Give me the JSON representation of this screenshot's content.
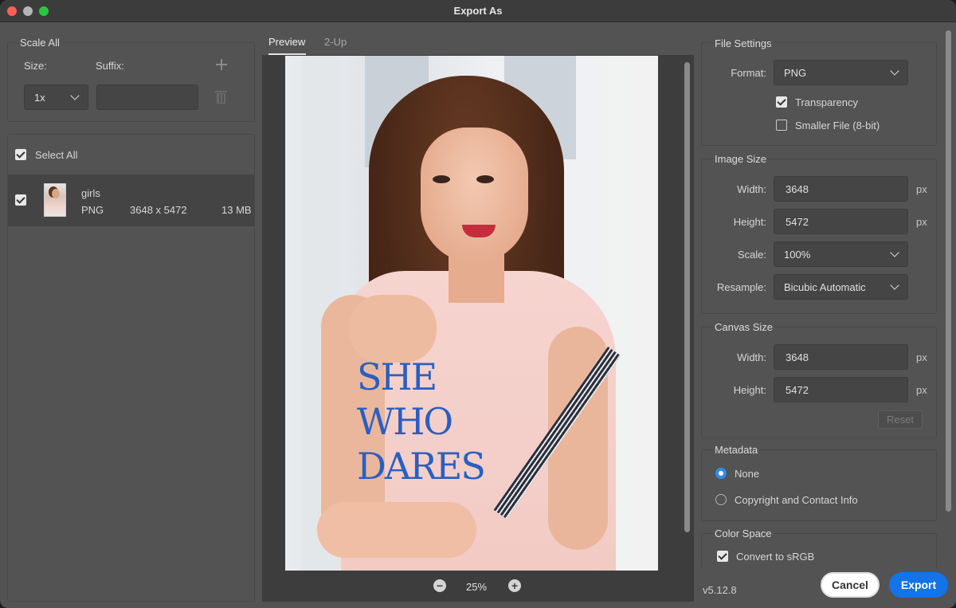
{
  "window": {
    "title": "Export As"
  },
  "scale_all": {
    "title": "Scale All",
    "size_label": "Size:",
    "suffix_label": "Suffix:",
    "size_value": "1x",
    "suffix_value": ""
  },
  "assets": {
    "select_all_label": "Select All",
    "select_all_checked": true,
    "items": [
      {
        "name": "girls",
        "format": "PNG",
        "dimensions": "3648 x 5472",
        "size": "13 MB",
        "checked": true
      }
    ]
  },
  "tabs": [
    {
      "label": "Preview",
      "active": true
    },
    {
      "label": "2-Up",
      "active": false
    }
  ],
  "preview": {
    "shirt_text": [
      "SHE",
      "WHO",
      "DARES"
    ],
    "zoom": "25%"
  },
  "file_settings": {
    "title": "File Settings",
    "format_label": "Format:",
    "format_value": "PNG",
    "transparency_label": "Transparency",
    "transparency_checked": true,
    "smaller_file_label": "Smaller File (8-bit)",
    "smaller_file_checked": false
  },
  "image_size": {
    "title": "Image Size",
    "width_label": "Width:",
    "width_value": "3648",
    "height_label": "Height:",
    "height_value": "5472",
    "scale_label": "Scale:",
    "scale_value": "100%",
    "resample_label": "Resample:",
    "resample_value": "Bicubic Automatic",
    "unit": "px"
  },
  "canvas_size": {
    "title": "Canvas Size",
    "width_label": "Width:",
    "width_value": "3648",
    "height_label": "Height:",
    "height_value": "5472",
    "unit": "px",
    "reset_label": "Reset"
  },
  "metadata": {
    "title": "Metadata",
    "options": [
      {
        "label": "None",
        "selected": true
      },
      {
        "label": "Copyright and Contact Info",
        "selected": false
      }
    ]
  },
  "color_space": {
    "title": "Color Space",
    "convert_label": "Convert to sRGB",
    "convert_checked": true
  },
  "footer": {
    "version": "v5.12.8",
    "cancel_label": "Cancel",
    "export_label": "Export"
  },
  "colors": {
    "accent": "#1473e6",
    "radio_selected": "#2d8ceb",
    "panel_bg": "#535353",
    "preview_bg": "#3d3d3d"
  }
}
